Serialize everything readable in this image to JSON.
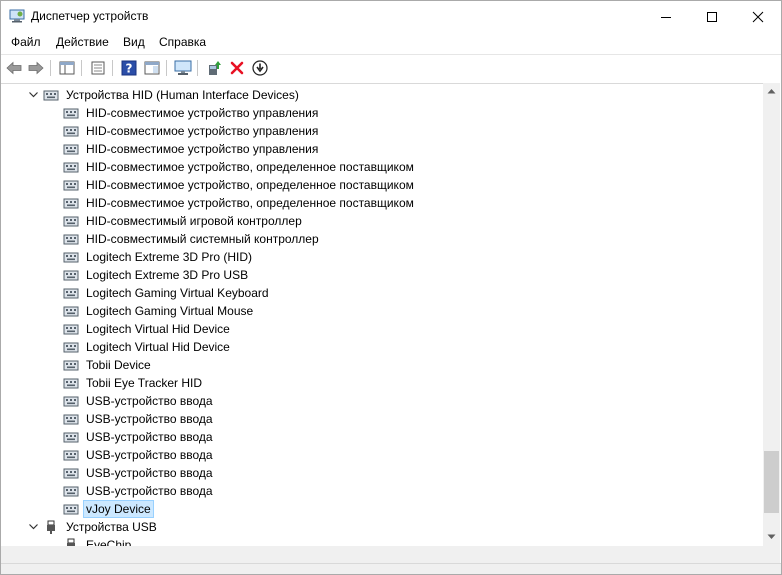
{
  "window": {
    "title": "Диспетчер устройств"
  },
  "menu": {
    "items": [
      "Файл",
      "Действие",
      "Вид",
      "Справка"
    ]
  },
  "tree": {
    "hid_category": "Устройства HID (Human Interface Devices)",
    "hid_devices": [
      "HID-совместимое устройство управления",
      "HID-совместимое устройство управления",
      "HID-совместимое устройство управления",
      "HID-совместимое устройство, определенное поставщиком",
      "HID-совместимое устройство, определенное поставщиком",
      "HID-совместимое устройство, определенное поставщиком",
      "HID-совместимый игровой контроллер",
      "HID-совместимый системный контроллер",
      "Logitech Extreme 3D Pro (HID)",
      "Logitech Extreme 3D Pro USB",
      "Logitech Gaming Virtual Keyboard",
      "Logitech Gaming Virtual Mouse",
      "Logitech Virtual Hid Device",
      "Logitech Virtual Hid Device",
      "Tobii Device",
      "Tobii Eye Tracker HID",
      "USB-устройство ввода",
      "USB-устройство ввода",
      "USB-устройство ввода",
      "USB-устройство ввода",
      "USB-устройство ввода",
      "USB-устройство ввода",
      "vJoy Device"
    ],
    "selected_device": "vJoy Device",
    "usb_category": "Устройства USB",
    "usb_devices": [
      "EyeChip"
    ]
  },
  "colors": {
    "selection_bg": "#cce8ff",
    "selection_border": "#99d1ff",
    "remove_red": "#e81123",
    "help_blue": "#2b4ea8"
  }
}
